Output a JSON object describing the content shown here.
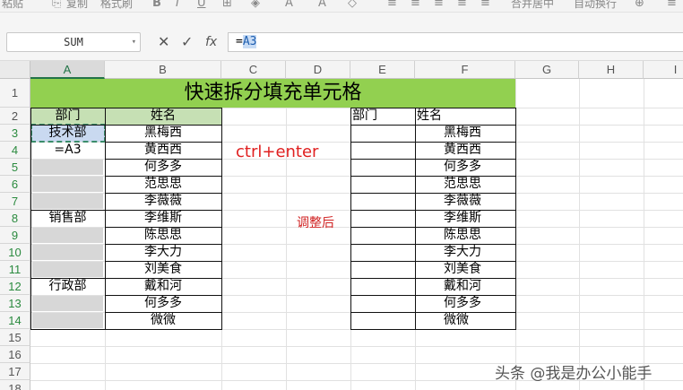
{
  "toolbar": {
    "paste": "粘贴",
    "copy": "复制",
    "format_painter": "格式刷",
    "merge_center": "合并居中",
    "wrap_text": "自动换行"
  },
  "formula_bar": {
    "name_box": "SUM",
    "formula_prefix": "=",
    "formula_ref": "A3",
    "fx_label": "fx"
  },
  "columns": [
    "A",
    "B",
    "C",
    "D",
    "E",
    "F",
    "G",
    "H",
    "I"
  ],
  "rows": [
    "1",
    "2",
    "3",
    "4",
    "5",
    "6",
    "7",
    "8",
    "9",
    "10",
    "11",
    "12",
    "13",
    "14",
    "15",
    "16",
    "17",
    "18"
  ],
  "sheet": {
    "title": "快速拆分填充单元格",
    "left_table": {
      "headers": [
        "部门",
        "姓名"
      ],
      "departments": [
        "技术部",
        "=A3",
        "",
        "",
        "",
        "销售部",
        "",
        "",
        "",
        "行政部",
        "",
        ""
      ],
      "names": [
        "黑梅西",
        "黄西西",
        "何多多",
        "范思思",
        "李薇薇",
        "李维斯",
        "陈思思",
        "李大力",
        "刘美食",
        "戴和河",
        "何多多",
        "微微"
      ]
    },
    "right_table": {
      "headers": [
        "部门",
        "姓名"
      ],
      "departments": [
        "",
        "",
        "",
        "",
        "",
        "",
        "",
        "",
        "",
        "",
        "",
        ""
      ],
      "names": [
        "黑梅西",
        "黄西西",
        "何多多",
        "范思思",
        "李薇薇",
        "李维斯",
        "陈思思",
        "李大力",
        "刘美食",
        "戴和河",
        "何多多",
        "微微"
      ]
    },
    "annotation_shortcut": "ctrl+enter",
    "annotation_after": "调整后"
  },
  "watermark": "头条 @我是办公小能手",
  "colors": {
    "title_fill": "#92d050",
    "header_fill": "#c6e0b4",
    "selection_fill": "#c9d9f0",
    "annotation_red": "#e02020"
  }
}
